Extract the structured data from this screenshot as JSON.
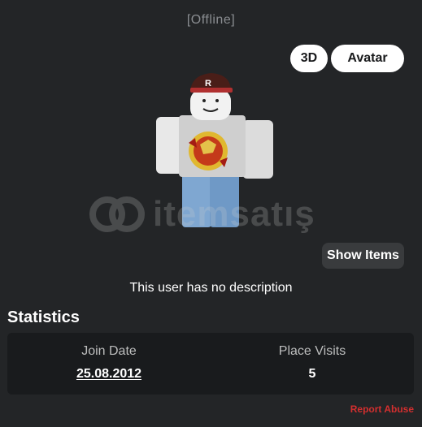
{
  "profile": {
    "status": "[Offline]",
    "description": "This user has no description"
  },
  "view_toggle": {
    "btn_3d": "3D",
    "btn_avatar": "Avatar"
  },
  "avatar": {
    "show_items_label": "Show Items"
  },
  "watermark": {
    "text": "itemsatış"
  },
  "statistics": {
    "title": "Statistics",
    "join_date_label": "Join Date",
    "join_date_value": "25.08.2012",
    "place_visits_label": "Place Visits",
    "place_visits_value": "5"
  },
  "footer": {
    "report_label": "Report Abuse",
    "report_color": "#d32f2f"
  }
}
